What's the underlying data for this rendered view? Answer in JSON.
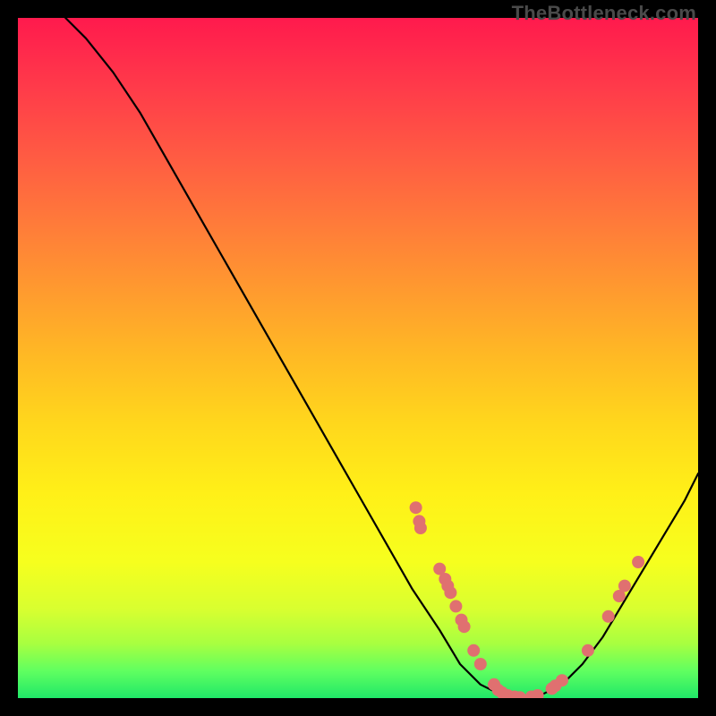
{
  "attribution": "TheBottleneck.com",
  "colors": {
    "marker": "#e07070",
    "curve": "#000000",
    "frame": "#000000",
    "gradient_top": "#ff1a4d",
    "gradient_bottom": "#20e868"
  },
  "chart_data": {
    "type": "line",
    "title": "",
    "xlabel": "",
    "ylabel": "",
    "xlim": [
      0,
      100
    ],
    "ylim": [
      0,
      100
    ],
    "curve": [
      {
        "x": 7,
        "y": 100
      },
      {
        "x": 10,
        "y": 97
      },
      {
        "x": 14,
        "y": 92
      },
      {
        "x": 18,
        "y": 86
      },
      {
        "x": 22,
        "y": 79
      },
      {
        "x": 26,
        "y": 72
      },
      {
        "x": 30,
        "y": 65
      },
      {
        "x": 34,
        "y": 58
      },
      {
        "x": 38,
        "y": 51
      },
      {
        "x": 42,
        "y": 44
      },
      {
        "x": 46,
        "y": 37
      },
      {
        "x": 50,
        "y": 30
      },
      {
        "x": 54,
        "y": 23
      },
      {
        "x": 58,
        "y": 16
      },
      {
        "x": 62,
        "y": 10
      },
      {
        "x": 65,
        "y": 5
      },
      {
        "x": 68,
        "y": 2
      },
      {
        "x": 71,
        "y": 0.5
      },
      {
        "x": 74,
        "y": 0
      },
      {
        "x": 77,
        "y": 0.5
      },
      {
        "x": 80,
        "y": 2
      },
      {
        "x": 83,
        "y": 5
      },
      {
        "x": 86,
        "y": 9
      },
      {
        "x": 89,
        "y": 14
      },
      {
        "x": 92,
        "y": 19
      },
      {
        "x": 95,
        "y": 24
      },
      {
        "x": 98,
        "y": 29
      },
      {
        "x": 100,
        "y": 33
      }
    ],
    "markers": [
      {
        "x": 58.5,
        "y": 28
      },
      {
        "x": 59,
        "y": 26
      },
      {
        "x": 59.2,
        "y": 25
      },
      {
        "x": 62,
        "y": 19
      },
      {
        "x": 62.8,
        "y": 17.5
      },
      {
        "x": 63.2,
        "y": 16.5
      },
      {
        "x": 63.6,
        "y": 15.5
      },
      {
        "x": 64.4,
        "y": 13.5
      },
      {
        "x": 65.2,
        "y": 11.5
      },
      {
        "x": 65.6,
        "y": 10.5
      },
      {
        "x": 67,
        "y": 7
      },
      {
        "x": 68,
        "y": 5
      },
      {
        "x": 70,
        "y": 2
      },
      {
        "x": 70.6,
        "y": 1.2
      },
      {
        "x": 71.2,
        "y": 0.8
      },
      {
        "x": 72,
        "y": 0.4
      },
      {
        "x": 73,
        "y": 0.2
      },
      {
        "x": 73.8,
        "y": 0.1
      },
      {
        "x": 75.5,
        "y": 0.2
      },
      {
        "x": 76.4,
        "y": 0.4
      },
      {
        "x": 78.5,
        "y": 1.4
      },
      {
        "x": 79,
        "y": 1.8
      },
      {
        "x": 80,
        "y": 2.6
      },
      {
        "x": 83.8,
        "y": 7
      },
      {
        "x": 86.8,
        "y": 12
      },
      {
        "x": 88.4,
        "y": 15
      },
      {
        "x": 89.2,
        "y": 16.5
      },
      {
        "x": 91.2,
        "y": 20
      }
    ]
  }
}
